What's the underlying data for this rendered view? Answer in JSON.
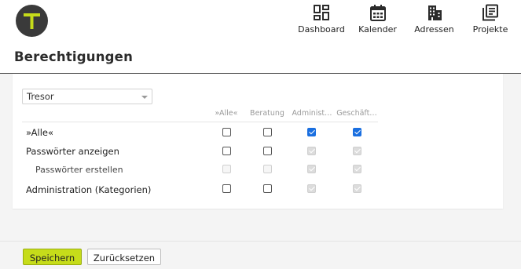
{
  "brand": {
    "logo_letter": "T",
    "logo_color": "#c6dc1a"
  },
  "nav": [
    {
      "label": "Dashboard",
      "icon": "dashboard-icon"
    },
    {
      "label": "Kalender",
      "icon": "calendar-icon"
    },
    {
      "label": "Adressen",
      "icon": "building-icon"
    },
    {
      "label": "Projekte",
      "icon": "projects-icon"
    }
  ],
  "page": {
    "title": "Berechtigungen"
  },
  "selector": {
    "value": "Tresor"
  },
  "columns": [
    "»Alle«",
    "Beratung",
    "Administ…",
    "Geschäft…"
  ],
  "rows": [
    {
      "label": "»Alle«",
      "indent": false,
      "checks": [
        false,
        false,
        true,
        true
      ],
      "disabled": [
        false,
        false,
        false,
        false
      ]
    },
    {
      "label": "Passwörter anzeigen",
      "indent": false,
      "checks": [
        false,
        false,
        true,
        true
      ],
      "disabled": [
        false,
        false,
        true,
        true
      ]
    },
    {
      "label": "Passwörter erstellen",
      "indent": true,
      "checks": [
        false,
        false,
        true,
        true
      ],
      "disabled": [
        true,
        true,
        true,
        true
      ]
    },
    {
      "label": "Administration (Kategorien)",
      "indent": false,
      "checks": [
        false,
        false,
        true,
        true
      ],
      "disabled": [
        false,
        false,
        true,
        true
      ]
    }
  ],
  "actions": {
    "save_label": "Speichern",
    "reset_label": "Zurücksetzen"
  },
  "colors": {
    "accent": "#c6dc1a",
    "checkbox_checked": "#1a6fe0",
    "page_bg": "#f4f4f4"
  }
}
